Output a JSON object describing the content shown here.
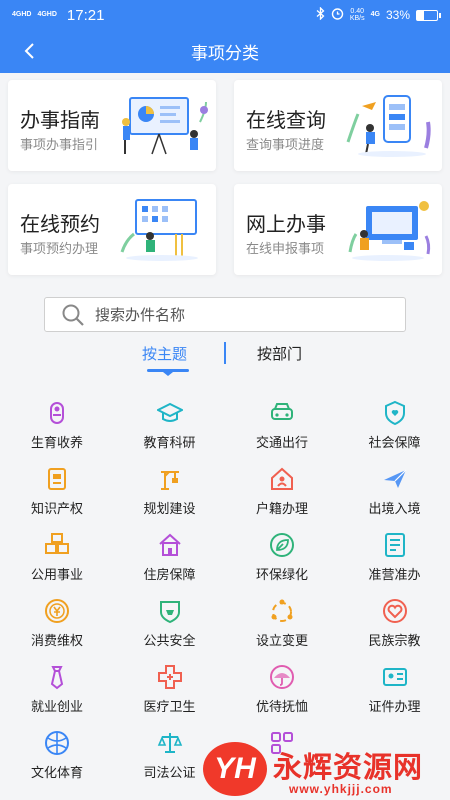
{
  "status_bar": {
    "signal1": "4GHD",
    "signal2": "4GHD",
    "time": "17:21",
    "net_speed": "0.40",
    "net_unit": "KB/s",
    "net_type": "4G",
    "battery": "33%",
    "battery_level": 0.33
  },
  "nav": {
    "title": "事项分类",
    "back_icon": "chevron-left-icon"
  },
  "cards": [
    {
      "title": "办事指南",
      "subtitle": "事项办事指引",
      "icon": "guide-illustration"
    },
    {
      "title": "在线查询",
      "subtitle": "查询事项进度",
      "icon": "query-illustration"
    },
    {
      "title": "在线预约",
      "subtitle": "事项预约办理",
      "icon": "appointment-illustration"
    },
    {
      "title": "网上办事",
      "subtitle": "在线申报事项",
      "icon": "online-service-illustration"
    }
  ],
  "search": {
    "placeholder": "搜索办件名称"
  },
  "tabs": {
    "topic": "按主题",
    "department": "按部门",
    "active": "topic"
  },
  "categories": [
    {
      "label": "生育收养",
      "icon": "baby-icon",
      "color": "#b44fd8"
    },
    {
      "label": "教育科研",
      "icon": "graduation-cap-icon",
      "color": "#1fb5c7"
    },
    {
      "label": "交通出行",
      "icon": "car-icon",
      "color": "#2fb37a"
    },
    {
      "label": "社会保障",
      "icon": "shield-heart-icon",
      "color": "#1fb5c7"
    },
    {
      "label": "知识产权",
      "icon": "document-icon",
      "color": "#f0a020"
    },
    {
      "label": "规划建设",
      "icon": "crane-icon",
      "color": "#f0a020"
    },
    {
      "label": "户籍办理",
      "icon": "house-person-icon",
      "color": "#f06050"
    },
    {
      "label": "出境入境",
      "icon": "airplane-icon",
      "color": "#3a86f5"
    },
    {
      "label": "公用事业",
      "icon": "boxes-icon",
      "color": "#f0a020"
    },
    {
      "label": "住房保障",
      "icon": "house-icon",
      "color": "#b44fd8"
    },
    {
      "label": "环保绿化",
      "icon": "leaf-icon",
      "color": "#2fb37a"
    },
    {
      "label": "准营准办",
      "icon": "list-document-icon",
      "color": "#1fb5c7"
    },
    {
      "label": "消费维权",
      "icon": "yen-coin-icon",
      "color": "#f0a020"
    },
    {
      "label": "公共安全",
      "icon": "shield-badge-icon",
      "color": "#2fb37a"
    },
    {
      "label": "设立变更",
      "icon": "cycle-nodes-icon",
      "color": "#f0a020"
    },
    {
      "label": "民族宗教",
      "icon": "heart-circle-icon",
      "color": "#f06050"
    },
    {
      "label": "就业创业",
      "icon": "tie-icon",
      "color": "#b44fd8"
    },
    {
      "label": "医疗卫生",
      "icon": "medical-cross-icon",
      "color": "#f06050"
    },
    {
      "label": "优待抚恤",
      "icon": "umbrella-icon",
      "color": "#e05cb0"
    },
    {
      "label": "证件办理",
      "icon": "id-card-icon",
      "color": "#1fb5c7"
    },
    {
      "label": "文化体育",
      "icon": "ball-icon",
      "color": "#3a86f5"
    },
    {
      "label": "司法公证",
      "icon": "scales-icon",
      "color": "#1fb5c7"
    },
    {
      "label": "",
      "icon": "grid-icon",
      "color": "#b44fd8"
    }
  ],
  "watermark": {
    "logo": "YH",
    "name": "永辉资源网",
    "url": "www.yhkjjj.com"
  }
}
